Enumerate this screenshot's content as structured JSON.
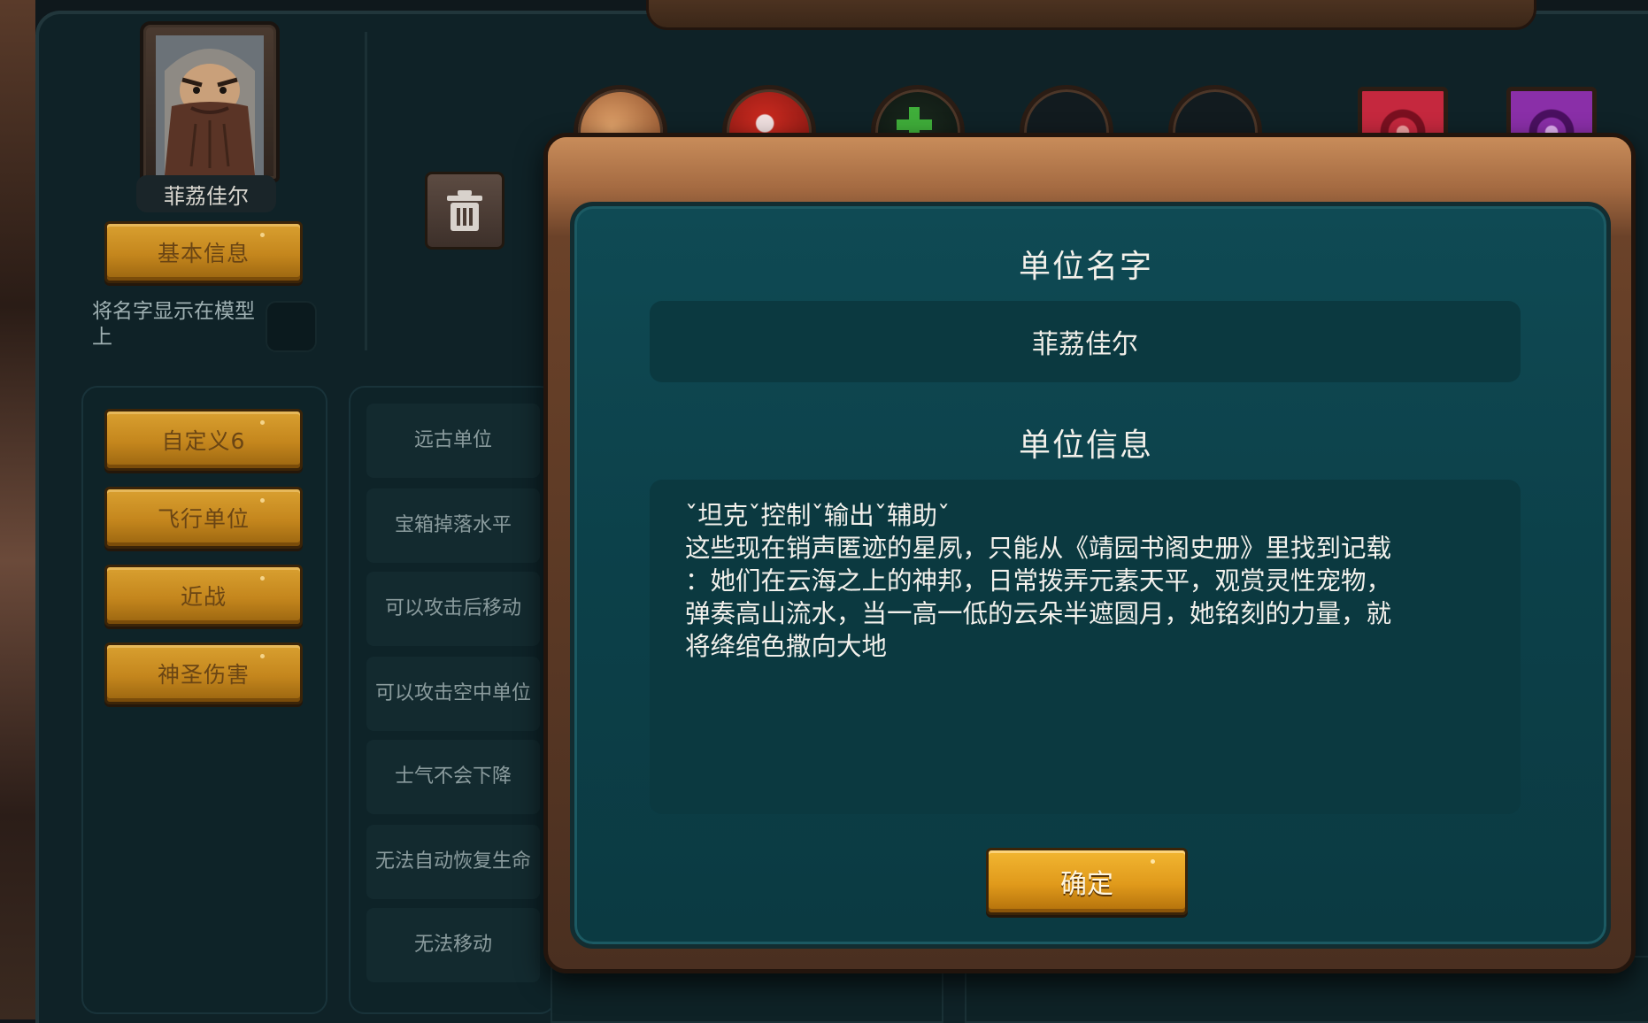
{
  "unit": {
    "portrait_name": "菲荔佳尔",
    "basic_info_button": "基本信息",
    "show_name_label": "将名字显示在模型上"
  },
  "tags": [
    {
      "label": "自定义6"
    },
    {
      "label": "飞行单位"
    },
    {
      "label": "近战"
    },
    {
      "label": "神圣伤害"
    }
  ],
  "attributes": [
    {
      "label": "远古单位"
    },
    {
      "label": "宝箱掉落水平"
    },
    {
      "label": "可以攻击后移动"
    },
    {
      "label": "可以攻击空中单位"
    },
    {
      "label": "士气不会下降"
    },
    {
      "label": "无法自动恢复生命"
    },
    {
      "label": "无法移动"
    }
  ],
  "top_icons": [
    {
      "icon": "fire-orb-icon",
      "color": "#b8683a"
    },
    {
      "icon": "blood-orb-icon",
      "color": "#a8201a"
    },
    {
      "icon": "heal-cross-orb-icon",
      "color": "#1f6f2a"
    },
    {
      "icon": "empty-orb-icon",
      "color": "#121b1f"
    },
    {
      "icon": "empty-orb-icon",
      "color": "#121b1f"
    },
    {
      "icon": "red-spiral-gem-icon",
      "color": "#b51e3a"
    },
    {
      "icon": "purple-spiral-gem-icon",
      "color": "#8a2fa8"
    }
  ],
  "modal": {
    "name_title": "单位名字",
    "name_value": "菲荔佳尔",
    "info_title": "单位信息",
    "info_value": "ˇ坦克ˇ控制ˇ输出ˇ辅助ˇ\n这些现在销声匿迹的星夙，只能从《靖园书阁史册》里找到记载\n：她们在云海之上的神邦，日常拨弄元素天平，观赏灵性宠物，\n弹奏高山流水，当一高一低的云朵半遮圆月，她铭刻的力量，就\n将绛绾色撒向大地",
    "confirm_label": "确定"
  },
  "colors": {
    "accent_gold": "#e09a1b",
    "panel_teal": "#0c4049",
    "frame_wood": "#a56b42"
  }
}
